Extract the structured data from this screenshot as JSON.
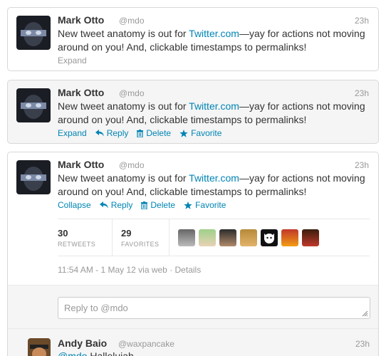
{
  "tweets": [
    {
      "name": "Mark Otto",
      "screen_name": "@mdo",
      "time": "23h",
      "text_before": "New tweet anatomy is out for ",
      "link": "Twitter.com",
      "text_after": "—yay for actions not moving around on you! And, clickable timestamps to permalinks!",
      "expand_label": "Expand"
    },
    {
      "name": "Mark Otto",
      "screen_name": "@mdo",
      "time": "23h",
      "text_before": "New tweet anatomy is out for ",
      "link": "Twitter.com",
      "text_after": "—yay for actions not moving around on you! And, clickable timestamps to permalinks!",
      "actions": {
        "expand": "Expand",
        "reply": "Reply",
        "delete": "Delete",
        "favorite": "Favorite"
      }
    },
    {
      "name": "Mark Otto",
      "screen_name": "@mdo",
      "time": "23h",
      "text_before": "New tweet anatomy is out for ",
      "link": "Twitter.com",
      "text_after": "—yay for actions not moving around on you! And, clickable timestamps to permalinks!",
      "actions": {
        "collapse": "Collapse",
        "reply": "Reply",
        "delete": "Delete",
        "favorite": "Favorite"
      },
      "stats": {
        "retweets": {
          "count": "30",
          "label": "RETWEETS"
        },
        "favorites": {
          "count": "29",
          "label": "FAVORITES"
        }
      },
      "detail": "11:54 AM - 1 May 12 via web · Details",
      "reply_placeholder": "Reply to @mdo",
      "reply": {
        "name": "Andy Baio",
        "screen_name": "@waxpancake",
        "time": "23h",
        "mention": "@mdo",
        "text": " Hallelujah."
      }
    }
  ],
  "colors": {
    "link": "#0084b4",
    "muted": "#999999",
    "text": "#333333"
  }
}
